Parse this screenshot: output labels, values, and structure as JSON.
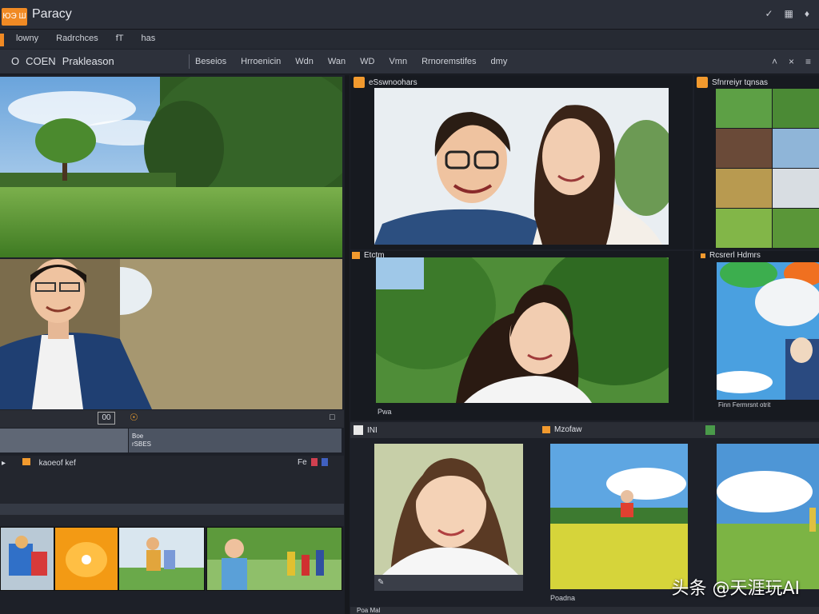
{
  "app": {
    "logo_text": "ЮЭ Ш",
    "title": "Paracy"
  },
  "titlebar_icons": [
    "check-icon",
    "grid-icon",
    "puzzle-icon"
  ],
  "menu": {
    "items": [
      "lowny",
      "Radrchces",
      "fT",
      "has"
    ]
  },
  "toolbar": {
    "left": [
      "O",
      "COEN",
      "Prakleason"
    ],
    "tabs": [
      "Beseios",
      "Hrroenicin",
      "Wdn",
      "Wan",
      "WD",
      "Vmn",
      "Rrnoremstifes",
      "dmy"
    ],
    "right": [
      "caret-icon",
      "close-icon",
      "menu-icon"
    ]
  },
  "left_panel": {
    "timecode": "00",
    "control_icon": "loop-icon",
    "corner_icon": "export-icon",
    "track_label_1": "Boe",
    "track_label_2": "rSBES",
    "tools_label": "kaoeof kef",
    "tools_right": "Fe"
  },
  "right_panels": {
    "top_label": "eSswnoohars",
    "top_right_label": "Sfnrreiyr tqnsas",
    "mid_label": "Etctm",
    "mid_caption": "Pwa",
    "mid_right_label": "Rcsrerl Hdmrs",
    "mid_right_caption": "Finn Fermrsnt otrit",
    "bottom_label_1": "INI",
    "bottom_label_2": "Mzofaw",
    "bottom_caption": "Poadna",
    "status_label": "Poa Mal"
  },
  "watermark": "头条 @天涯玩AI"
}
